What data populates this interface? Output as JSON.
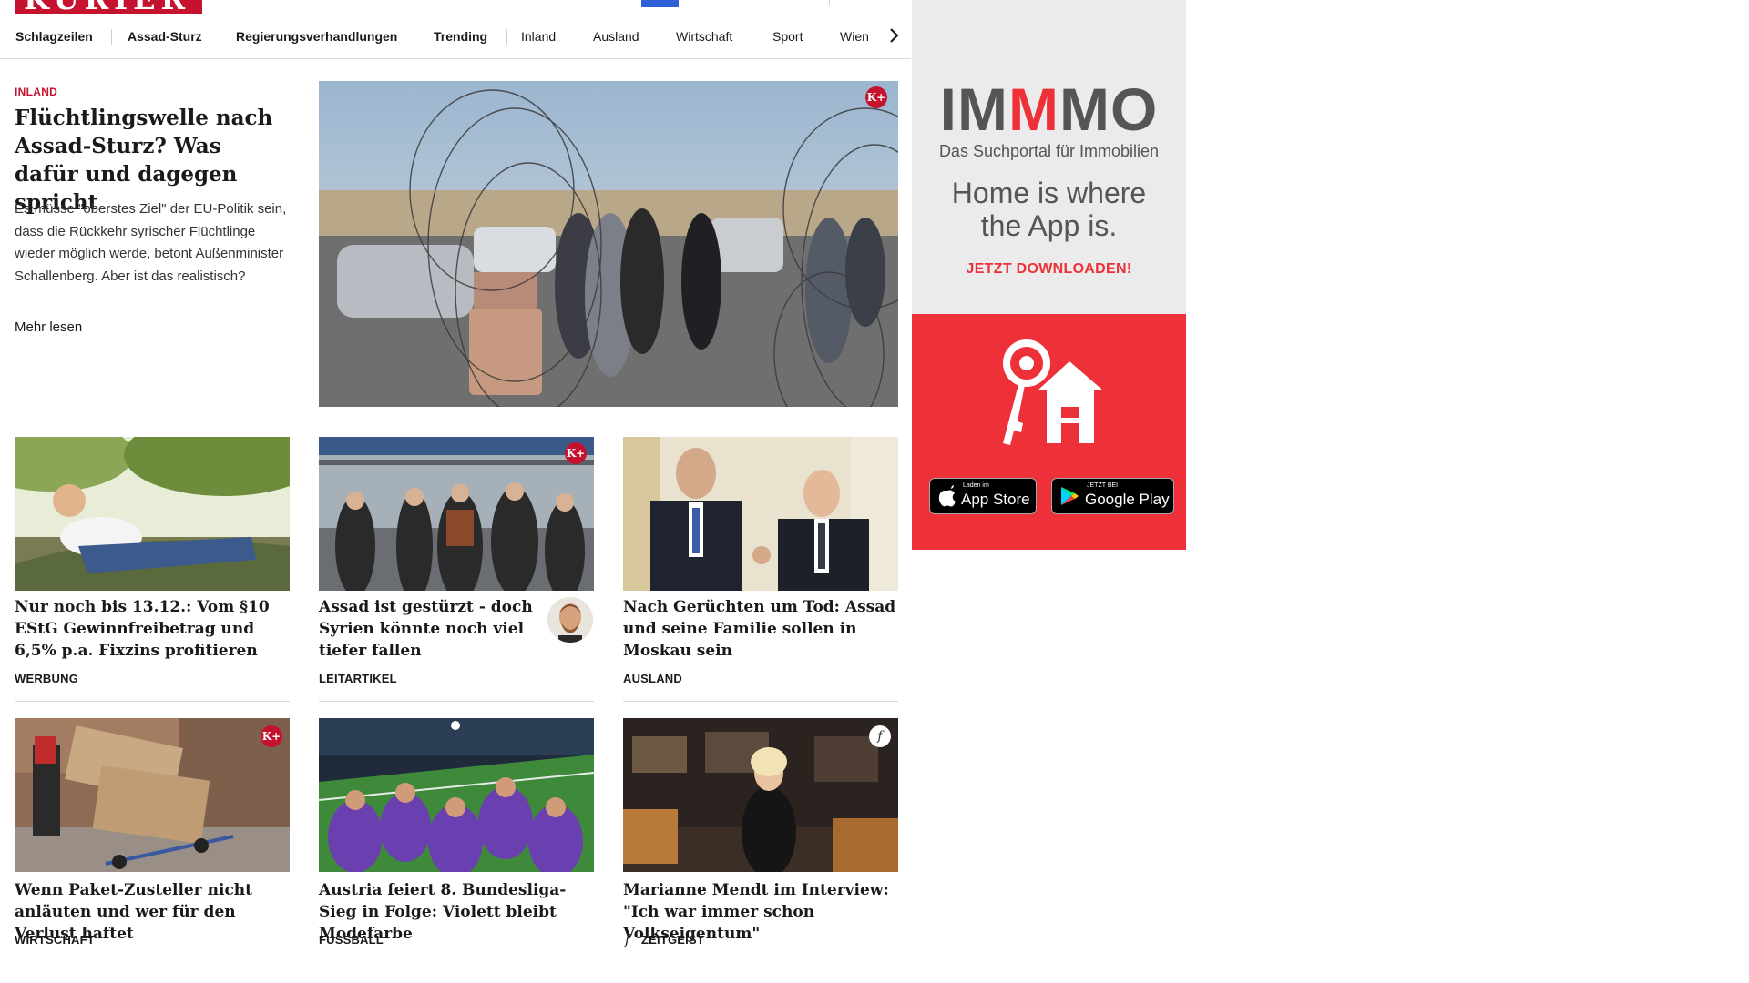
{
  "header": {
    "nav": [
      {
        "label": "Schlagzeilen",
        "bold": true
      },
      {
        "label": "Assad-Sturz",
        "bold": true
      },
      {
        "label": "Regierungsverhandlungen",
        "bold": true
      },
      {
        "label": "Trending",
        "bold": true
      },
      {
        "label": "Inland",
        "bold": false
      },
      {
        "label": "Ausland",
        "bold": false
      },
      {
        "label": "Wirtschaft",
        "bold": false
      },
      {
        "label": "Sport",
        "bold": false
      },
      {
        "label": "Wien",
        "bold": false
      }
    ]
  },
  "lead": {
    "kicker": "INLAND",
    "headline": "Flüchtlingswelle nach Assad-Sturz? Was dafür und dagegen spricht",
    "teaser": "Es müsse \"oberstes Ziel\" der EU-Politik sein, dass die Rückkehr syrischer Flüchtlinge wieder möglich werde, betont Außenminister Schallenberg. Aber ist das realistisch?",
    "more_label": "Mehr lesen",
    "badge": "K+"
  },
  "cards": [
    {
      "title": "Nur noch bis 13.12.: Vom §10 EStG Gewinnfreibetrag und 6,5% p.a. Fixzins profitieren",
      "kicker": "WERBUNG",
      "badge": ""
    },
    {
      "title": "Assad ist gestürzt - doch Syrien könnte noch viel tie­fer fallen",
      "kicker": "LEITARTIKEL",
      "badge": "K+"
    },
    {
      "title": "Nach Gerüchten um Tod: Assad und seine Familie sollen in Moskau sein",
      "kicker": "AUSLAND",
      "badge": ""
    },
    {
      "title": "Wenn Paket-Zusteller nicht anläu­ten und wer für den Verlust haftet",
      "kicker": "WIRTSCHAFT",
      "badge": "K+"
    },
    {
      "title": "Austria feiert 8. Bundesliga-Sieg in Folge: Violett bleibt Modefarbe",
      "kicker": "FUSSBALL",
      "badge": ""
    },
    {
      "title": "Marianne Mendt im Interview: \"Ich war immer schon Volkseigentum\"",
      "kicker": "ZEITGEIST",
      "badge": "f"
    }
  ],
  "ad": {
    "brand": "IMMMO",
    "sub": "Das Suchportal für Immobilien",
    "slogan": "Home is where the App is.",
    "cta": "JETZT DOWNLOADEN!",
    "app_store_small": "Laden im",
    "app_store_big": "App Store",
    "google_small": "JETZT BEI",
    "google_big": "Google Play"
  },
  "colors": {
    "brand_red": "#c4122f",
    "ad_red": "#ee3038",
    "ad_bg": "#ebebeb"
  },
  "icons": {
    "nav_next": "chevron-right-icon",
    "premium": "kplus-icon",
    "filter": "kfilter-icon"
  }
}
